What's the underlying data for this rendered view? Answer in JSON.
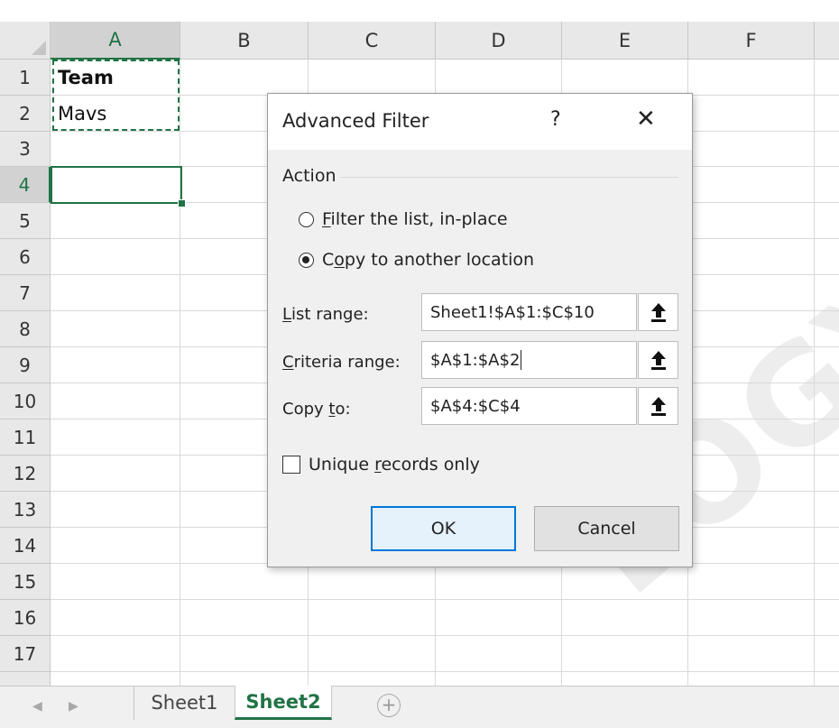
{
  "grid": {
    "columns": [
      "A",
      "B",
      "C",
      "D",
      "E",
      "F"
    ],
    "rows": [
      "1",
      "2",
      "3",
      "4",
      "5",
      "6",
      "7",
      "8",
      "9",
      "10",
      "11",
      "12",
      "13",
      "14",
      "15",
      "16",
      "17"
    ],
    "active_column": "A",
    "active_row": "4",
    "cells": {
      "A1": "Team",
      "A2": "Mavs"
    }
  },
  "dialog": {
    "title": "Advanced Filter",
    "help_glyph": "?",
    "close_glyph": "✕",
    "action_group_label": "Action",
    "radio_filter_inplace": {
      "mnemonic": "F",
      "rest": "ilter the list, in-place",
      "checked": false
    },
    "radio_copy_location": {
      "pre": "C",
      "mnemonic": "o",
      "rest": "py to another location",
      "checked": true
    },
    "list_range": {
      "mnemonic": "L",
      "rest": "ist range:",
      "value": "Sheet1!$A$1:$C$10"
    },
    "criteria_range": {
      "mnemonic": "C",
      "rest": "riteria range:",
      "value": "$A$1:$A$2"
    },
    "copy_to": {
      "pre": "Copy ",
      "mnemonic": "t",
      "rest": "o:",
      "value": "$A$4:$C$4"
    },
    "unique_records": {
      "pre": "Unique ",
      "mnemonic": "r",
      "rest": "ecords only",
      "checked": false
    },
    "ok_label": "OK",
    "cancel_label": "Cancel"
  },
  "sheet_tabs": {
    "tabs": [
      "Sheet1",
      "Sheet2"
    ],
    "active": "Sheet2",
    "prev_glyph": "◀",
    "next_glyph": "▶",
    "add_glyph": "+"
  },
  "watermark": {
    "text": "LOGY"
  },
  "colors": {
    "excel_green": "#217346",
    "dialog_bg": "#f0f0f0",
    "ok_focus_border": "#0078d7"
  }
}
